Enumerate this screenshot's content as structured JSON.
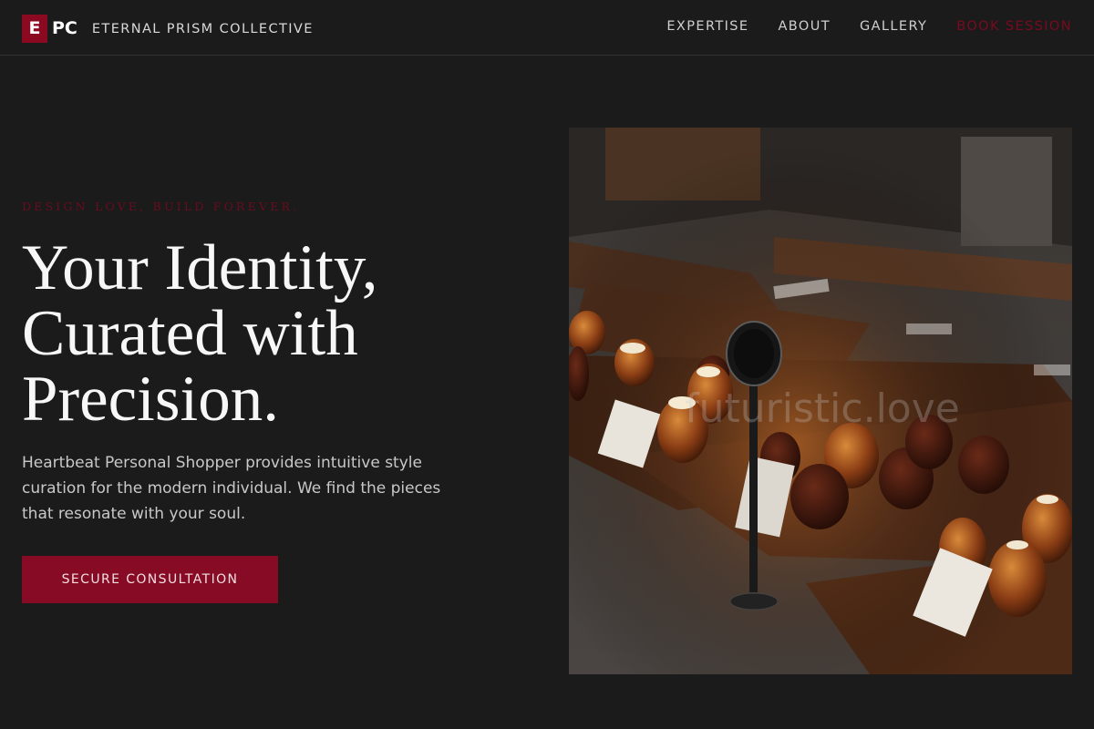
{
  "header": {
    "logo_mark": "E",
    "logo_text": "PC",
    "brand_name": "ETERNAL PRISM COLLECTIVE",
    "nav": [
      {
        "label": "EXPERTISE"
      },
      {
        "label": "ABOUT"
      },
      {
        "label": "GALLERY"
      },
      {
        "label": "BOOK SESSION"
      }
    ]
  },
  "hero": {
    "tagline": "DESIGN LOVE, BUILD FOREVER.",
    "headline_lines": [
      "Your Identity,",
      "Curated with",
      "Precision."
    ],
    "description": "Heartbeat Personal Shopper provides intuitive style curation for the modern individual. We find the pieces that resonate with your soul.",
    "cta_label": "SECURE CONSULTATION",
    "image_watermark": "futuristic.love"
  },
  "colors": {
    "background": "#1b1b1c",
    "accent": "#870b24",
    "text": "#f7f7f7",
    "muted_text": "#c8c8c8"
  }
}
